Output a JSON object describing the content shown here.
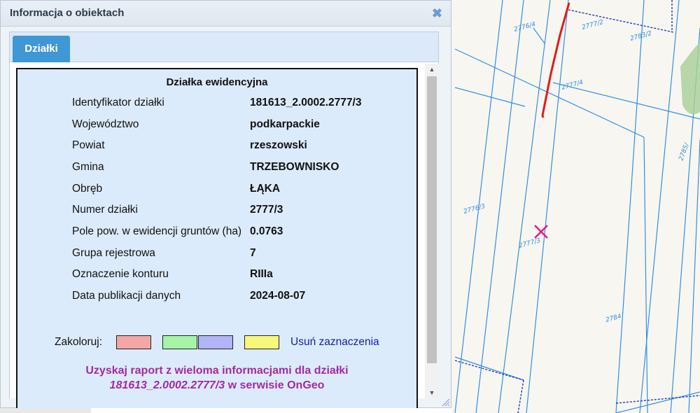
{
  "dialog": {
    "title": "Informacja o obiektach",
    "close_icon": "close-icon",
    "tab_label": "Działki"
  },
  "parcel": {
    "heading": "Działka ewidencyjna",
    "rows": [
      {
        "label": "Identyfikator działki",
        "value": "181613_2.0002.2777/3"
      },
      {
        "label": "Województwo",
        "value": "podkarpackie"
      },
      {
        "label": "Powiat",
        "value": "rzeszowski"
      },
      {
        "label": "Gmina",
        "value": "TRZEBOWNISKO"
      },
      {
        "label": "Obręb",
        "value": "ŁĄKA"
      },
      {
        "label": "Numer działki",
        "value": "2777/3"
      },
      {
        "label": "Pole pow. w ewidencji gruntów (ha)",
        "value": "0.0763"
      },
      {
        "label": "Grupa rejestrowa",
        "value": "7"
      },
      {
        "label": "Oznaczenie konturu",
        "value": "RIIIa"
      },
      {
        "label": "Data publikacji danych",
        "value": "2024-08-07"
      }
    ]
  },
  "colorize": {
    "label": "Zakoloruj:",
    "swatches": [
      "#f4a6a6",
      "#a6f4a6",
      "#b3b3f7",
      "#f7f77a"
    ],
    "clear_label": "Usuń zaznaczenia"
  },
  "report": {
    "line1": "Uzyskaj raport z wieloma informacjami dla działki",
    "parcel_id": "181613_2.0002.2777/3",
    "line2_suffix": " w serwisie OnGeo"
  },
  "map": {
    "parcel_line_color": "#2f8fe8",
    "selection_color": "#e8178a",
    "boundary_color": "#e01b1b",
    "labels": [
      "2776/4",
      "2777/2",
      "2783/2",
      "2777/4",
      "2785/",
      "2776/3",
      "2777/3",
      "2784"
    ]
  }
}
